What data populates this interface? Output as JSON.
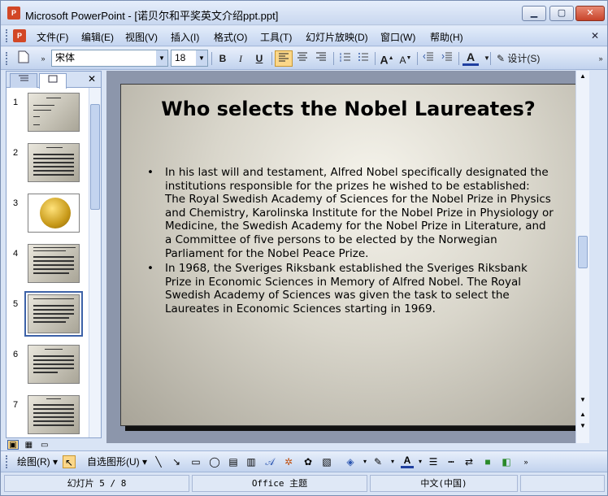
{
  "window": {
    "title": "Microsoft PowerPoint - [诺贝尔和平奖英文介绍ppt.ppt]",
    "app_icon": "powerpoint-icon",
    "buttons": {
      "minimize": "▁",
      "maximize": "▢",
      "close": "✕"
    }
  },
  "menu": {
    "items": [
      "文件(F)",
      "编辑(E)",
      "视图(V)",
      "插入(I)",
      "格式(O)",
      "工具(T)",
      "幻灯片放映(D)",
      "窗口(W)",
      "帮助(H)"
    ],
    "close": "✕"
  },
  "toolbar": {
    "font_name": "宋体",
    "font_size": "18",
    "bold": "B",
    "italic": "I",
    "underline": "U",
    "grow_font": "A",
    "shrink_font": "A",
    "font_color": "A",
    "design_label": "设计(S)"
  },
  "left_panel": {
    "tabs": [
      "outline",
      "slides"
    ],
    "close": "✕",
    "thumbnails": [
      {
        "num": "1"
      },
      {
        "num": "2"
      },
      {
        "num": "3"
      },
      {
        "num": "4"
      },
      {
        "num": "5"
      },
      {
        "num": "6"
      },
      {
        "num": "7"
      }
    ]
  },
  "slide": {
    "title": "Who selects the Nobel Laureates?",
    "bullets": [
      "In his last will and testament, Alfred Nobel specifically designated the institutions responsible for the prizes he wished to be established: The Royal Swedish Academy of Sciences for the Nobel Prize in Physics and Chemistry, Karolinska Institute for the Nobel Prize in Physiology or Medicine, the Swedish Academy for the Nobel Prize in Literature, and a Committee of five persons to be elected by the Norwegian Parliament for the Nobel Peace Prize.",
      "In 1968, the Sveriges Riksbank established the Sveriges Riksbank Prize in Economic Sciences in Memory of Alfred Nobel. The Royal Swedish Academy of Sciences was given the task to select the Laureates in Economic Sciences starting in 1969."
    ]
  },
  "drawing_toolbar": {
    "draw_label": "绘图(R)",
    "autoshapes_label": "自选图形(U)"
  },
  "status": {
    "slide_pos": "幻灯片 5 / 8",
    "theme": "Office 主题",
    "language": "中文(中国)"
  },
  "colors": {
    "accent_selected": "#3d62a8",
    "toolbar_active": "#fbd789"
  }
}
